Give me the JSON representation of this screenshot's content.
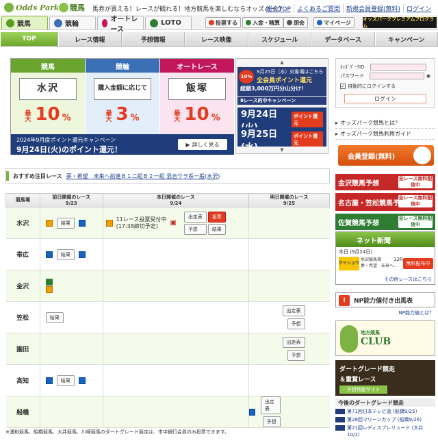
{
  "header": {
    "brand": "Odds Park",
    "sub_brand": "競馬",
    "tagline": "馬券が買える！レースが観れる！地方競馬を楽しむならオッズパーク",
    "links": [
      "総合TOP",
      "よくあるご質問",
      "新規会員登録(無料)",
      "ログイン"
    ]
  },
  "tabs": [
    {
      "label": "競馬",
      "color": "#5a9e22"
    },
    {
      "label": "競輪",
      "color": "#3b6fb6"
    },
    {
      "label": "オートレース",
      "color": "#c2185b"
    },
    {
      "label": "LOTO",
      "color": "#2e7d32"
    }
  ],
  "tool_buttons": [
    {
      "label": "投票する",
      "color": "#e23b1e"
    },
    {
      "label": "入金・精算",
      "color": "#2e7d32"
    },
    {
      "label": "閉会",
      "color": "#555555"
    },
    {
      "label": "マイページ",
      "color": "#1565c0"
    }
  ],
  "premium": "オッズパークプレミアムプログラム",
  "nav": [
    "TOP",
    "レース情報",
    "予想情報",
    "レース映像",
    "スケジュール",
    "データベース",
    "キャンペーン"
  ],
  "banner": {
    "cols": [
      {
        "head": "競馬",
        "venue": "水沢",
        "prefix": "最大",
        "value": "10",
        "unit": "%",
        "bg": "#eef6dc",
        "hc": "#6aa530"
      },
      {
        "head": "競輪",
        "venue": "購入金額に応じて",
        "prefix": "最大",
        "value": "3",
        "unit": "%",
        "bg": "#e3eefb",
        "hc": "#3b6fb6"
      },
      {
        "head": "オートレース",
        "venue": "飯塚",
        "prefix": "最大",
        "value": "10",
        "unit": "%",
        "bg": "#fbe3ef",
        "hc": "#c2185b"
      }
    ],
    "campaign_line1": "2024年9月度ポイント還元キャンペーン",
    "campaign_line2": "9月24日(火)のポイント還元！",
    "more": "詳しく見る"
  },
  "carousel": {
    "slide1_sub": "9月25日（水）対象場はこちら",
    "slide1_main": "全会員ポイント還元",
    "slide1_line": "総額3,000万円分山分け！",
    "slide1_line2": "8レース的中キャンペーン",
    "badge": "10%",
    "slides": [
      {
        "date": "9月24日(火)",
        "tag": "ポイント還元"
      },
      {
        "date": "9月25日(水)",
        "tag": "ポイント還元"
      }
    ]
  },
  "login": {
    "id_label": "ｵｯｽﾞﾊﾟｰｸID",
    "pw_label": "パスワード",
    "auto": "自動的にログインする",
    "button": "ログイン"
  },
  "side_links": [
    "オッズパーク競馬とは？",
    "オッズパーク競馬利用ガイド"
  ],
  "register": "会員登録(無料)",
  "predictions": [
    {
      "label": "金沢競馬予想",
      "tag": "全レース無料配信中",
      "color": "red"
    },
    {
      "label": "名古屋・笠松競馬予想",
      "tag": "全レース無料配信中",
      "color": "red"
    },
    {
      "label": "佐賀競馬予想",
      "tag": "全レース無料配信中",
      "color": "green"
    }
  ],
  "netnews": {
    "title": "ネット新聞",
    "date": "本日 (9月24日)",
    "paper": "ケイシュウ",
    "venue": "水沢競馬場",
    "race": "12R",
    "desc": "夢・希望　未来へ…",
    "buy": "無料配布中",
    "more": "その他レースはこちら"
  },
  "np": {
    "title": "NP能力値付き出馬表",
    "link": "NP能力値とは？"
  },
  "club": {
    "small": "地方競馬",
    "title": "CLUB"
  },
  "dirt": {
    "line1": "ダートグレード競走",
    "line2": "＆重賞レース",
    "cta": "予想特設サイト"
  },
  "dirt_grade": {
    "title": "今後のダートグレード競走",
    "items": [
      "第71回日本テレビ盃 (船橋9/25)",
      "第28回マリーンカップ (船橋9/26)",
      "第21回レディスプレリュード (大井10/1)"
    ]
  },
  "recommend": {
    "label": "おすすめ注目レース",
    "value": "夢・希望　未来へ前進Ｂ１二組Ｂ２一組 混合サラ系一般(水沢)"
  },
  "table": {
    "headers": {
      "venue": "競馬場",
      "prev": "前日開催のレース",
      "prev_date": "9/23",
      "today": "本日開催のレース",
      "today_date": "9/24",
      "next": "明日開催のレース",
      "next_date": "9/25"
    },
    "rows": [
      {
        "venue": "水沢",
        "prev": "day",
        "prev_btn": "結果",
        "today": "day",
        "today_msg1": "11レース投票受付中",
        "today_msg2": "(17:38締切予定)",
        "today_btns": [
          "出走表",
          "投票",
          "予想",
          "結果"
        ],
        "next": []
      },
      {
        "venue": "帯広",
        "prev": "night",
        "prev_btn": "結果",
        "today": "",
        "next": []
      },
      {
        "venue": "金沢",
        "prev": "multi",
        "prev_btn": "",
        "today": "",
        "next": []
      },
      {
        "venue": "笠松",
        "prev": "",
        "prev_btn": "結果",
        "today": "",
        "next": [
          "出走表",
          "予想"
        ]
      },
      {
        "venue": "園田",
        "prev": "",
        "prev_btn": "",
        "today": "",
        "next": [
          "出走表",
          "予想"
        ]
      },
      {
        "venue": "高知",
        "prev": "night",
        "prev_btn": "結果",
        "today": "",
        "next": []
      },
      {
        "venue": "船橋",
        "prev": "",
        "prev_btn": "",
        "today": "",
        "next": [
          "出走表",
          "予想"
        ]
      }
    ]
  },
  "footnote": "※浦和競馬、船橋競馬、大井競馬、川崎競馬のダートグレード競走は、市中銀行会員のみ投票できます。"
}
